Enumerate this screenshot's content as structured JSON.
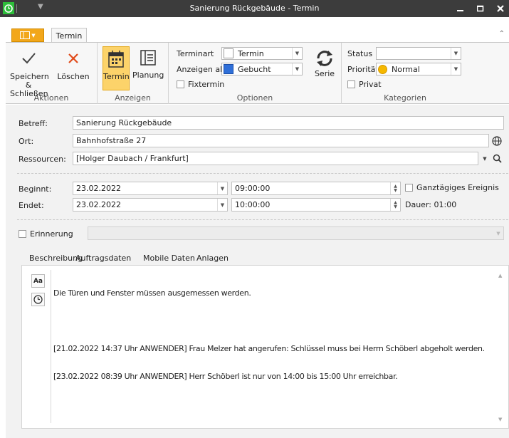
{
  "window": {
    "title": "Sanierung Rückgebäude - Termin"
  },
  "ribbon": {
    "tab_label": "Termin",
    "groups": {
      "aktionen": {
        "label": "Aktionen",
        "save_label_line1": "Speichern",
        "save_label_line2": "& Schließen",
        "delete_label": "Löschen"
      },
      "anzeigen": {
        "label": "Anzeigen",
        "termin_label": "Termin",
        "planung_label": "Planung"
      },
      "optionen": {
        "label": "Optionen",
        "terminart_label": "Terminart",
        "terminart_value": "Termin",
        "anzeigen_als_label": "Anzeigen als",
        "anzeigen_als_value": "Gebucht",
        "fixtermin_label": "Fixtermin",
        "serie_label": "Serie"
      },
      "kategorien": {
        "label": "Kategorien",
        "status_label": "Status",
        "status_value": "",
        "prioritaet_label": "Priorität",
        "prioritaet_value": "Normal",
        "privat_label": "Privat"
      }
    }
  },
  "form": {
    "betreff_label": "Betreff:",
    "betreff_value": "Sanierung Rückgebäude",
    "ort_label": "Ort:",
    "ort_value": "Bahnhofstraße 27",
    "ressourcen_label": "Ressourcen:",
    "ressourcen_value": "[Holger Daubach / Frankfurt]",
    "beginnt_label": "Beginnt:",
    "beginnt_date": "23.02.2022",
    "beginnt_time": "09:00:00",
    "endet_label": "Endet:",
    "endet_date": "23.02.2022",
    "endet_time": "10:00:00",
    "ganztaegig_label": "Ganztägiges Ereignis",
    "dauer_label": "Dauer:",
    "dauer_value": "01:00",
    "erinnerung_label": "Erinnerung",
    "tabs": [
      "Beschreibung",
      "Auftragsdaten",
      "Mobile Daten",
      "Anlagen"
    ],
    "description_lines": [
      "Die Türen und Fenster müssen ausgemessen werden.",
      "",
      "[21.02.2022 14:37 Uhr ANWENDER] Frau Melzer hat angerufen: Schlüssel muss bei Herrn Schöberl abgeholt werden.",
      "[23.02.2022 08:39 Uhr ANWENDER] Herr Schöberl ist nur von 14:00 bis 15:00 Uhr erreichbar."
    ],
    "font_button_label": "Aa"
  },
  "colors": {
    "accent_orange": "#f2a71b",
    "active_button": "#fcd36a",
    "titlebar": "#3c3c3c",
    "app_icon_green": "#2dbe3a",
    "delete_red": "#e04a1a",
    "gebucht_blue": "#2f6fd8",
    "priority_yellow": "#f5b800"
  },
  "icons": {
    "app": "alarm-clock-icon",
    "save": "checkmark-icon",
    "delete": "x-icon",
    "termin": "calendar-icon",
    "planung": "list-icon",
    "serie": "refresh-icon",
    "ort": "globe-icon",
    "ressourcen": "search-icon",
    "reminder": "clock-icon"
  }
}
